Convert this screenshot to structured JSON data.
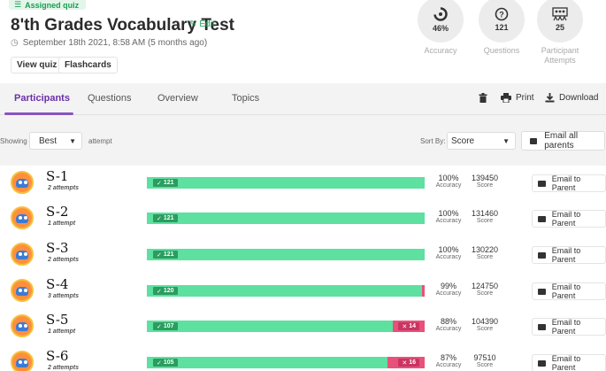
{
  "header": {
    "assigned_badge": "Assigned quiz",
    "title": "8'th Grades Vocabulary Test",
    "edit_label": "Edit",
    "date": "September 18th 2021, 8:58 AM (5 months ago)",
    "view_quiz": "View quiz",
    "flashcards": "Flashcards"
  },
  "stats": {
    "accuracy": {
      "value": "46%",
      "label": "Accuracy",
      "fraction": 0.46
    },
    "questions": {
      "value": "121",
      "label": "Questions"
    },
    "attempts": {
      "value": "25",
      "label": "Participant Attempts"
    }
  },
  "tabs": {
    "participants": "Participants",
    "questions": "Questions",
    "overview": "Overview",
    "topics": "Topics"
  },
  "toolbar": {
    "print": "Print",
    "download": "Download"
  },
  "filters": {
    "showing_label": "Showing",
    "showing_value": "Best",
    "attempt_label": "attempt",
    "sort_label": "Sort By:",
    "sort_value": "Score",
    "email_all": "Email all parents"
  },
  "participants": [
    {
      "name": "S-1",
      "attempts": "2 attempts",
      "correct": "121",
      "wrong": "",
      "correct_count": 121,
      "wrong_count": 0,
      "accuracy": "100%",
      "accuracy_label": "Accuracy",
      "score": "139450",
      "score_label": "Score",
      "email": "Email to Parent"
    },
    {
      "name": "S-2",
      "attempts": "1 attempt",
      "correct": "121",
      "wrong": "",
      "correct_count": 121,
      "wrong_count": 0,
      "accuracy": "100%",
      "accuracy_label": "Accuracy",
      "score": "131460",
      "score_label": "Score",
      "email": "Email to Parent"
    },
    {
      "name": "S-3",
      "attempts": "2 attempts",
      "correct": "121",
      "wrong": "",
      "correct_count": 121,
      "wrong_count": 0,
      "accuracy": "100%",
      "accuracy_label": "Accuracy",
      "score": "130220",
      "score_label": "Score",
      "email": "Email to Parent"
    },
    {
      "name": "S-4",
      "attempts": "3 attempts",
      "correct": "120",
      "wrong": "",
      "correct_count": 120,
      "wrong_count": 1,
      "accuracy": "99%",
      "accuracy_label": "Accuracy",
      "score": "124750",
      "score_label": "Score",
      "email": "Email to Parent"
    },
    {
      "name": "S-5",
      "attempts": "1 attempt",
      "correct": "107",
      "wrong": "14",
      "correct_count": 107,
      "wrong_count": 14,
      "accuracy": "88%",
      "accuracy_label": "Accuracy",
      "score": "104390",
      "score_label": "Score",
      "email": "Email to Parent"
    },
    {
      "name": "S-6",
      "attempts": "2 attempts",
      "correct": "105",
      "wrong": "16",
      "correct_count": 105,
      "wrong_count": 16,
      "accuracy": "87%",
      "accuracy_label": "Accuracy",
      "score": "97510",
      "score_label": "Score",
      "email": "Email to Parent"
    }
  ],
  "colors": {
    "accent_purple": "#8854c0",
    "correct_green": "#5de0a0",
    "wrong_red": "#e8517a",
    "brand_green": "#26a65b"
  }
}
